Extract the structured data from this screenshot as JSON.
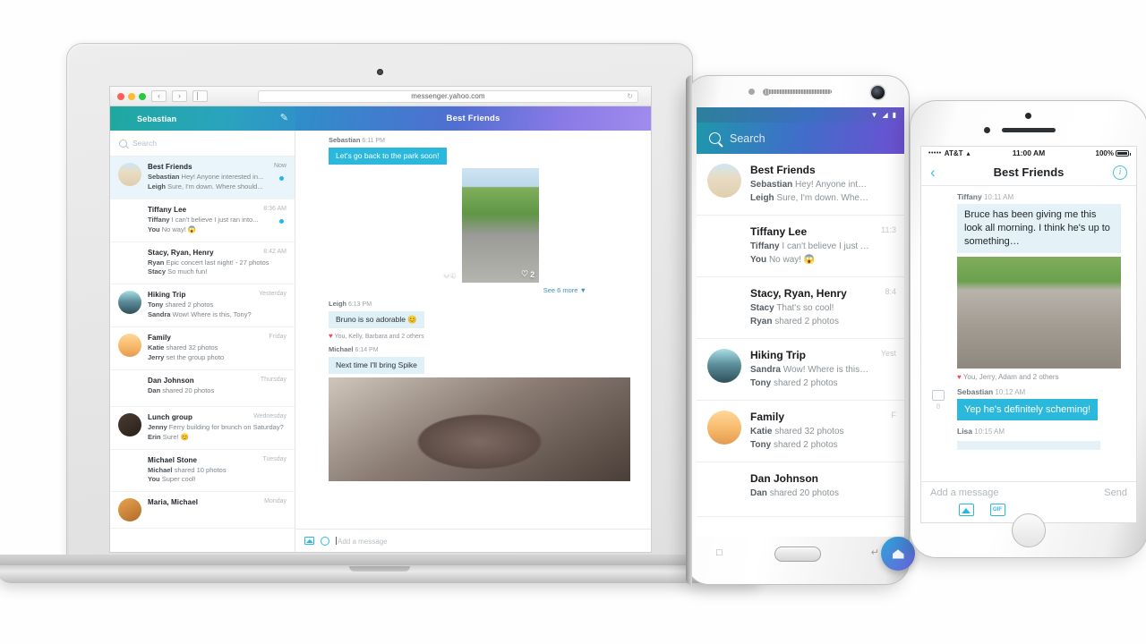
{
  "laptop": {
    "browser": {
      "url": "messenger.yahoo.com",
      "back_label": "‹",
      "forward_label": "›",
      "reload_label": "↻"
    },
    "header": {
      "user_name": "Sebastian",
      "compose_icon": "compose-pencil-icon",
      "conversation_title": "Best Friends"
    },
    "search": {
      "placeholder": "Search"
    },
    "conversations": [
      {
        "title": "Best Friends",
        "time": "Now",
        "line1_sender": "Sebastian",
        "line1_text": "Hey! Anyone interested in...",
        "line2_sender": "Leigh",
        "line2_text": "Sure, I'm down. Where should...",
        "unread": true,
        "avatar": "art-beach"
      },
      {
        "title": "Tiffany Lee",
        "time": "8:36 AM",
        "line1_sender": "Tiffany",
        "line1_text": "I can't believe I just ran into...",
        "line2_sender": "You",
        "line2_text": "No way! 😱",
        "unread": true,
        "avatar": "art-woman-red"
      },
      {
        "title": "Stacy, Ryan, Henry",
        "time": "8:42 AM",
        "line1_sender": "Ryan",
        "line1_text": "Epic concert last night! - 27 photos",
        "line2_sender": "Stacy",
        "line2_text": "So much fun!",
        "unread": false,
        "avatar": "art-group"
      },
      {
        "title": "Hiking Trip",
        "time": "Yesterday",
        "line1_sender": "Tony",
        "line1_text": "shared 2 photos",
        "line2_sender": "Sandra",
        "line2_text": "Wow! Where is this, Tony?",
        "unread": false,
        "avatar": "art-hike"
      },
      {
        "title": "Family",
        "time": "Friday",
        "line1_sender": "Katie",
        "line1_text": "shared 32 photos",
        "line2_sender": "Jerry",
        "line2_text": "set the group photo",
        "unread": false,
        "avatar": "art-family"
      },
      {
        "title": "Dan Johnson",
        "time": "Thursday",
        "line1_sender": "Dan",
        "line1_text": "shared 20 photos",
        "line2_sender": "",
        "line2_text": "",
        "unread": false,
        "avatar": "art-dan"
      },
      {
        "title": "Lunch group",
        "time": "Wednesday",
        "line1_sender": "Jenny",
        "line1_text": "Ferry building for brunch on Saturday?",
        "line2_sender": "Erin",
        "line2_text": "Sure! 😊",
        "unread": false,
        "avatar": "art-lunch"
      },
      {
        "title": "Michael Stone",
        "time": "Tuesday",
        "line1_sender": "Michael",
        "line1_text": "shared 10 photos",
        "line2_sender": "You",
        "line2_text": "Super cool!",
        "unread": false,
        "avatar": "art-kid"
      },
      {
        "title": "Maria, Michael",
        "time": "Monday",
        "line1_sender": "",
        "line1_text": "",
        "line2_sender": "",
        "line2_text": "",
        "unread": false,
        "avatar": "art-maria"
      }
    ],
    "messages": [
      {
        "sender": "Sebastian",
        "time": "6:11 PM",
        "text": "Let's go back to the park soon!",
        "style": "me"
      },
      {
        "sender": "Leigh",
        "time": "6:13 PM",
        "text": "Bruno is so adorable 😊",
        "style": "light",
        "reaction": "You, Kelly, Barbara and 2 others"
      },
      {
        "sender": "Michael",
        "time": "6:14 PM",
        "text": "Next time I'll bring Spike",
        "style": "light"
      }
    ],
    "photo_likes": [
      "4",
      "2"
    ],
    "see_more": "See 6 more",
    "see_more_caret": "▼",
    "composer": {
      "placeholder": "Add a message",
      "photo_icon": "photo-icon",
      "emoji_icon": "emoji-icon"
    }
  },
  "android": {
    "status": {
      "wifi_icon": "wifi-icon",
      "signal_icon": "signal-icon",
      "battery_icon": "battery-icon"
    },
    "search": {
      "placeholder": "Search",
      "icon": "search-icon"
    },
    "conversations": [
      {
        "title": "Best Friends",
        "time": "",
        "line1_sender": "Sebastian",
        "line1_text": "Hey! Anyone interested in...",
        "line2_sender": "Leigh",
        "line2_text": "Sure, I'm down. Where should...",
        "avatar": "art-beach"
      },
      {
        "title": "Tiffany Lee",
        "time": "11:3",
        "line1_sender": "Tiffany",
        "line1_text": "I can't believe I just ran into...",
        "line2_sender": "You",
        "line2_text": "No way! 😱",
        "avatar": "art-woman-red"
      },
      {
        "title": "Stacy, Ryan, Henry",
        "time": "8:4",
        "line1_sender": "Stacy",
        "line1_text": "That's so cool!",
        "line2_sender": "Ryan",
        "line2_text": "shared 2 photos",
        "avatar": "art-group"
      },
      {
        "title": "Hiking Trip",
        "time": "Yest",
        "line1_sender": "Sandra",
        "line1_text": "Wow! Where is this Tony?",
        "line2_sender": "Tony",
        "line2_text": "shared 2 photos",
        "avatar": "art-hike"
      },
      {
        "title": "Family",
        "time": "F",
        "line1_sender": "Katie",
        "line1_text": "shared 32 photos",
        "line2_sender": "Tony",
        "line2_text": "shared 2 photos",
        "avatar": "art-family"
      },
      {
        "title": "Dan Johnson",
        "time": "",
        "line1_sender": "Dan",
        "line1_text": "shared 20 photos",
        "line2_sender": "",
        "line2_text": "",
        "avatar": "art-dan"
      }
    ],
    "fab": "compose-fab",
    "nav": {
      "recents_icon": "recents-icon",
      "back_icon": "back-icon",
      "home_button": "home-button"
    }
  },
  "iphone": {
    "status": {
      "signal": "•••••",
      "carrier": "AT&T",
      "wifi": "▴",
      "time": "11:00 AM",
      "battery": "100%"
    },
    "nav": {
      "back_icon": "back-chevron-icon",
      "title": "Best Friends",
      "info_label": "i"
    },
    "messages": [
      {
        "sender": "Tiffany",
        "time": "10:11 AM",
        "text": "Bruce has been giving me this look all morning. I think he's up to something…",
        "style": "them",
        "photo": "art-frenchie",
        "reaction": "You, Jerry, Adam and 2 others"
      },
      {
        "sender": "Sebastian",
        "time": "10:12 AM",
        "text": "Yep he's definitely scheming!",
        "style": "me"
      },
      {
        "sender": "Lisa",
        "time": "10:15 AM",
        "text": "",
        "style": "them"
      }
    ],
    "photo_count": "8",
    "composer": {
      "placeholder": "Add a message",
      "send_label": "Send",
      "camera_icon": "camera-icon",
      "photo_icon": "photo-icon",
      "gif_icon": "gif-icon",
      "gif_label": "GIF"
    }
  }
}
